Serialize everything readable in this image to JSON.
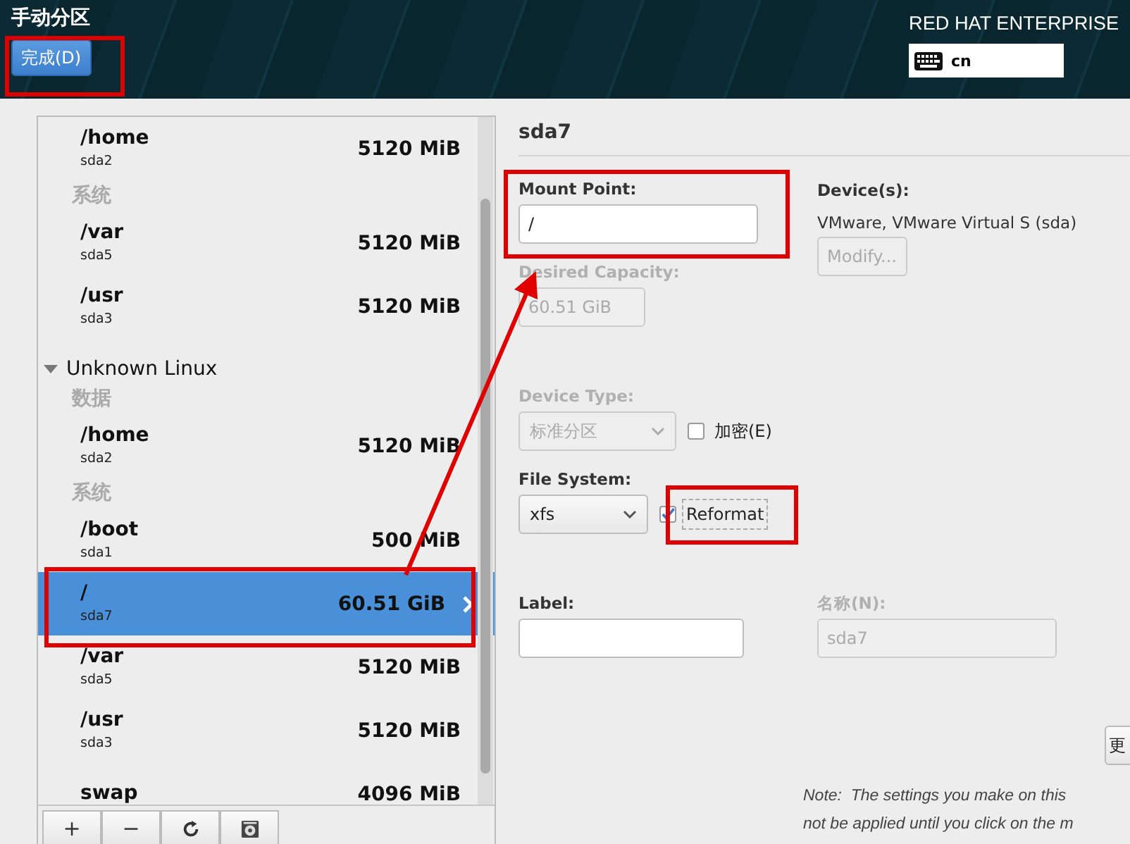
{
  "header": {
    "title": "手动分区",
    "done_button": "完成(D)",
    "product": "RED HAT ENTERPRISE",
    "keyboard_layout": "cn"
  },
  "partition_list": {
    "sections": [
      {
        "categories": [
          {
            "items": [
              {
                "mount": "/home",
                "device": "sda2",
                "size": "5120 MiB",
                "selected": false
              }
            ]
          },
          {
            "label": "系统",
            "items": [
              {
                "mount": "/var",
                "device": "sda5",
                "size": "5120 MiB",
                "selected": false
              },
              {
                "mount": "/usr",
                "device": "sda3",
                "size": "5120 MiB",
                "selected": false
              }
            ]
          }
        ]
      },
      {
        "name": "Unknown Linux",
        "expanded": true,
        "categories": [
          {
            "label": "数据",
            "items": [
              {
                "mount": "/home",
                "device": "sda2",
                "size": "5120 MiB",
                "selected": false
              }
            ]
          },
          {
            "label": "系统",
            "items": [
              {
                "mount": "/boot",
                "device": "sda1",
                "size": "500 MiB",
                "selected": false
              },
              {
                "mount": "/",
                "device": "sda7",
                "size": "60.51 GiB",
                "selected": true
              },
              {
                "mount": "/var",
                "device": "sda5",
                "size": "5120 MiB",
                "selected": false
              },
              {
                "mount": "/usr",
                "device": "sda3",
                "size": "5120 MiB",
                "selected": false
              },
              {
                "mount": "swap",
                "size": "4096 MiB",
                "selected": false
              }
            ]
          }
        ]
      }
    ],
    "toolbar": [
      {
        "kind": "text",
        "label": "+"
      },
      {
        "kind": "text",
        "label": "−"
      },
      {
        "kind": "refresh"
      },
      {
        "kind": "disk"
      }
    ]
  },
  "details": {
    "title": "sda7",
    "mount_point": {
      "label": "Mount Point:",
      "value": "/",
      "disabled": false
    },
    "desired_capacity": {
      "label": "Desired Capacity:",
      "value": "60.51 GiB",
      "disabled": true
    },
    "device_type": {
      "label": "Device Type:",
      "value": "标准分区",
      "disabled": true,
      "option": {
        "label": "加密(E)",
        "checked": false,
        "focused": false
      }
    },
    "file_system": {
      "label": "File System:",
      "value": "xfs",
      "disabled": false,
      "option": {
        "label": "Reformat",
        "checked": true,
        "focused": true
      }
    },
    "devices": {
      "label": "Device(s):",
      "text": "VMware, VMware Virtual S (sda)",
      "modify_button": {
        "label": "Modify...",
        "disabled": true
      }
    },
    "label_field": {
      "label": "Label:",
      "disabled": false
    },
    "name_field": {
      "label": "名称(N):",
      "value": "sda7",
      "disabled": true
    },
    "update_button": {
      "label": "更"
    },
    "note": [
      "Note:  The settings you make on this",
      "not be applied until you click on the m"
    ]
  }
}
